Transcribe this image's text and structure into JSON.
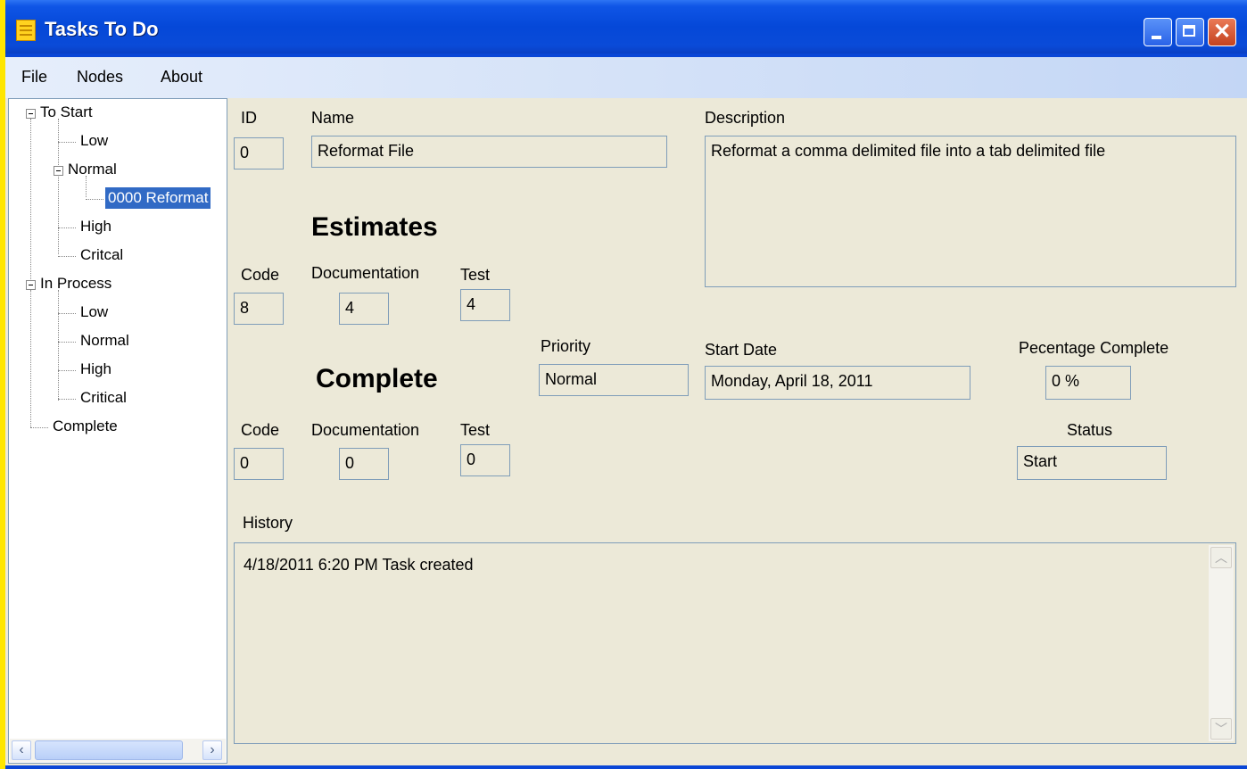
{
  "window": {
    "title": "Tasks To Do"
  },
  "menu": [
    "File",
    "Nodes",
    "About"
  ],
  "tree": {
    "to_start": "To Start",
    "to_start_low": "Low",
    "to_start_normal": "Normal",
    "to_start_normal_task": "0000 Reformat",
    "to_start_high": "High",
    "to_start_critical": "Critcal",
    "in_process": "In Process",
    "in_process_low": "Low",
    "in_process_normal": "Normal",
    "in_process_high": "High",
    "in_process_critical": "Critical",
    "complete": "Complete"
  },
  "form": {
    "id_label": "ID",
    "id_value": "0",
    "name_label": "Name",
    "name_value": "Reformat File",
    "description_label": "Description",
    "description_value": "Reformat a comma delimited file into a tab delimited file",
    "estimates_heading": "Estimates",
    "est_code_label": "Code",
    "est_code_value": "8",
    "est_doc_label": "Documentation",
    "est_doc_value": "4",
    "est_test_label": "Test",
    "est_test_value": "4",
    "priority_label": "Priority",
    "priority_value": "Normal",
    "start_date_label": "Start Date",
    "start_date_value": "Monday, April 18, 2011",
    "percent_label": "Pecentage Complete",
    "percent_value": "0 %",
    "complete_heading": "Complete",
    "cmp_code_label": "Code",
    "cmp_code_value": "0",
    "cmp_doc_label": "Documentation",
    "cmp_doc_value": "0",
    "cmp_test_label": "Test",
    "cmp_test_value": "0",
    "status_label": "Status",
    "status_value": "Start",
    "history_label": "History",
    "history_value": "4/18/2011 6:20 PM Task created"
  },
  "colors": {
    "selection": "#316ac5",
    "form_bg": "#ece9d8",
    "title_bar": "#0548d8",
    "desktop": "#ffe600"
  }
}
